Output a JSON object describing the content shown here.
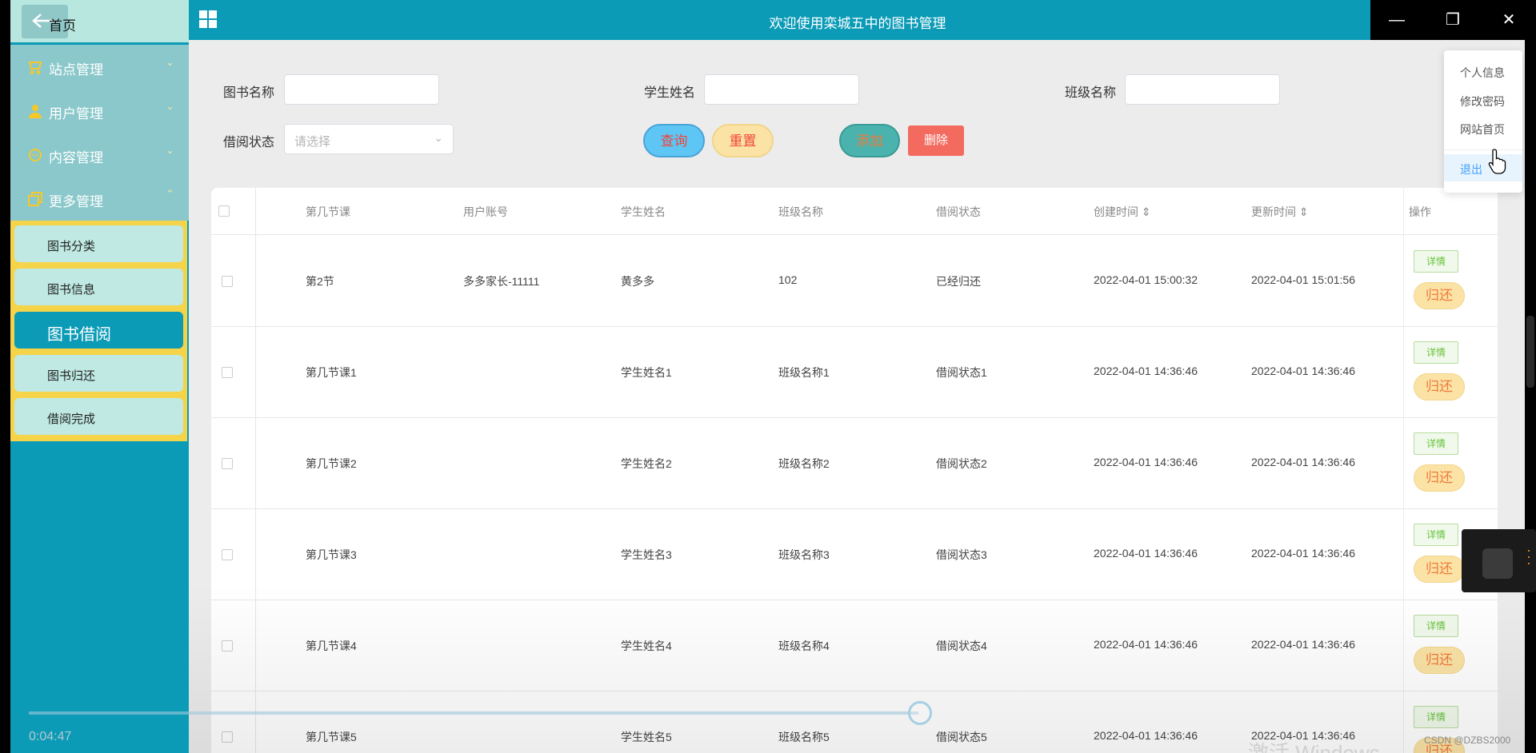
{
  "header": {
    "title": "欢迎使用栾城五中的图书管理"
  },
  "sidebar": {
    "home": "首页",
    "menus": [
      {
        "label": "站点管理",
        "icon": "shop-icon",
        "chev": "⌄"
      },
      {
        "label": "用户管理",
        "icon": "user-icon",
        "chev": "⌄"
      },
      {
        "label": "内容管理",
        "icon": "chat-icon",
        "chev": "⌄"
      },
      {
        "label": "更多管理",
        "icon": "copy-icon",
        "chev": "⌃"
      }
    ],
    "submenu": [
      "图书分类",
      "图书信息",
      "图书借阅",
      "图书归还",
      "借阅完成"
    ]
  },
  "filters": {
    "book_name_label": "图书名称",
    "student_name_label": "学生姓名",
    "class_name_label": "班级名称",
    "status_label": "借阅状态",
    "status_placeholder": "请选择"
  },
  "buttons": {
    "search": "查询",
    "reset": "重置",
    "add": "添加",
    "delete": "删除"
  },
  "table": {
    "headers": [
      "第几节课",
      "用户账号",
      "学生姓名",
      "班级名称",
      "借阅状态",
      "创建时间",
      "更新时间",
      "操作"
    ],
    "sort_glyph": "⇕",
    "detail_label": "详情",
    "return_label": "归还",
    "rows": [
      [
        "第2节",
        "多多家长-11111",
        "黄多多",
        "102",
        "已经归还",
        "2022-04-01 15:00:32",
        "2022-04-01 15:01:56"
      ],
      [
        "第几节课1",
        "",
        "学生姓名1",
        "班级名称1",
        "借阅状态1",
        "2022-04-01 14:36:46",
        "2022-04-01 14:36:46"
      ],
      [
        "第几节课2",
        "",
        "学生姓名2",
        "班级名称2",
        "借阅状态2",
        "2022-04-01 14:36:46",
        "2022-04-01 14:36:46"
      ],
      [
        "第几节课3",
        "",
        "学生姓名3",
        "班级名称3",
        "借阅状态3",
        "2022-04-01 14:36:46",
        "2022-04-01 14:36:46"
      ],
      [
        "第几节课4",
        "",
        "学生姓名4",
        "班级名称4",
        "借阅状态4",
        "2022-04-01 14:36:46",
        "2022-04-01 14:36:46"
      ],
      [
        "第几节课5",
        "",
        "学生姓名5",
        "班级名称5",
        "借阅状态5",
        "2022-04-01 14:36:46",
        "2022-04-01 14:36:46"
      ]
    ]
  },
  "dropdown": {
    "items": [
      "个人信息",
      "修改密码",
      "网站首页"
    ],
    "logout": "退出"
  },
  "video": {
    "time": "0:04:47",
    "progress": 0.83
  },
  "watermark": "CSDN @DZBS2000",
  "activate_text": "激活 Windows",
  "colors": {
    "primary": "#0b9bb7",
    "submenu_border": "#f5d44a",
    "danger": "#f36a5f"
  }
}
